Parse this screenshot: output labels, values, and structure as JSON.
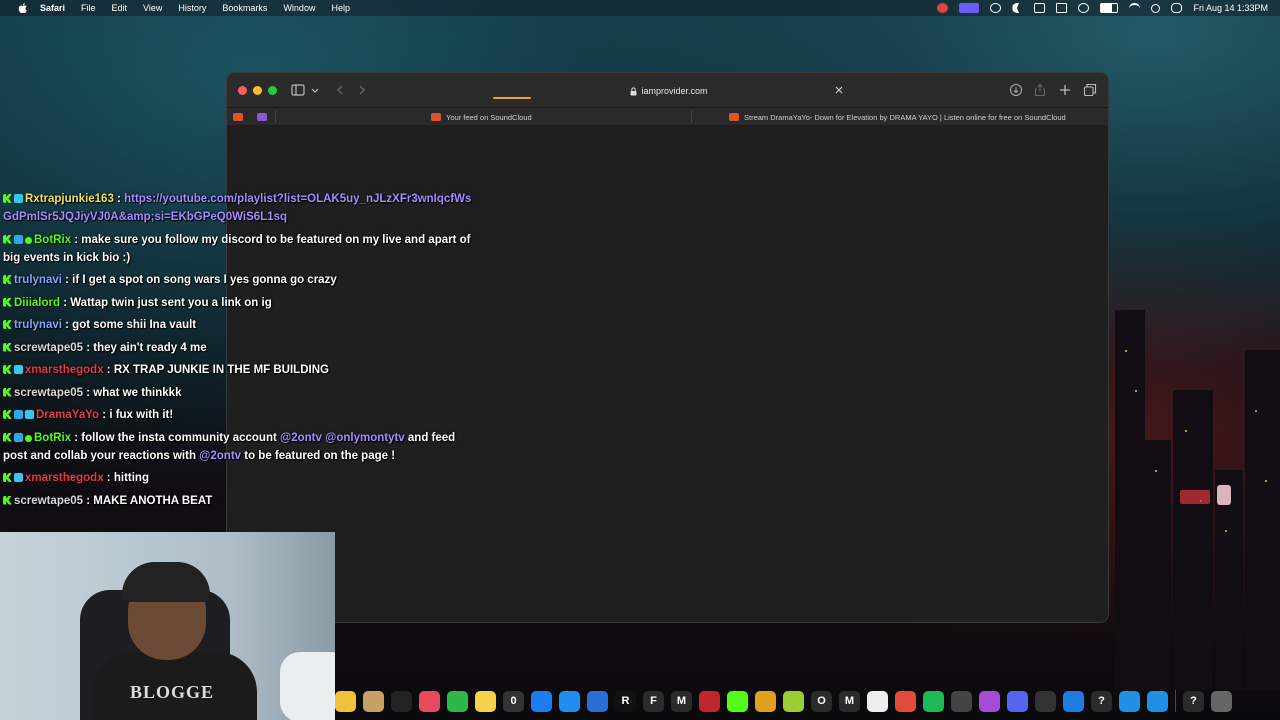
{
  "menubar": {
    "app_name": "Safari",
    "items": [
      "File",
      "Edit",
      "View",
      "History",
      "Bookmarks",
      "Window",
      "Help"
    ],
    "clock": "Fri Aug 14  1:33PM"
  },
  "browser": {
    "url": "iamprovider.com",
    "tabs": [
      {
        "label": "Your feed on SoundCloud"
      },
      {
        "label": "Stream DramaYaYo- Down for Elevation by DRAMA YAYO | Listen online for free on SoundCloud"
      }
    ]
  },
  "chat": {
    "messages": [
      {
        "user": "Rxtrapjunkie163",
        "user_color": "#f5e05a",
        "text": "",
        "link": "https://youtube.com/playlist?list=OLAK5uy_nJLzXFr3wnIqcfWsGdPmlSr5JQJiyVJ0A&amp;si=EKbGPeQ0WiS6L1sq",
        "badges": [
          "kick",
          "sub"
        ]
      },
      {
        "user": "BotRix",
        "user_color": "#53fc18",
        "text": "make sure you follow my discord to be featured on my live and apart of big events in kick bio :)",
        "badges": [
          "kick",
          "bot",
          "mod"
        ]
      },
      {
        "user": "trulynavi",
        "user_color": "#7fa8ff",
        "text": "if I get a spot on song wars I yes gonna go crazy",
        "badges": [
          "kick"
        ]
      },
      {
        "user": "Diiialord",
        "user_color": "#53fc18",
        "text": "Wattap twin just sent you a link on ig",
        "badges": [
          "kick"
        ]
      },
      {
        "user": "trulynavi",
        "user_color": "#7fa8ff",
        "text": "got some shii Ina vault",
        "badges": [
          "kick"
        ]
      },
      {
        "user": "screwtape05",
        "user_color": "#d8d8d8",
        "text": "they ain't ready 4 me",
        "badges": [
          "kick"
        ]
      },
      {
        "user": "xmarsthegodx",
        "user_color": "#e63a4c",
        "text": "RX TRAP JUNKIE IN THE MF BUILDING",
        "badges": [
          "kick",
          "sub"
        ]
      },
      {
        "user": "screwtape05",
        "user_color": "#d8d8d8",
        "text": "what we thinkkk",
        "badges": [
          "kick"
        ]
      },
      {
        "user": "DramaYaYo",
        "user_color": "#e63a4c",
        "text": "i fux with it!",
        "badges": [
          "kick",
          "bot",
          "sub"
        ]
      },
      {
        "user": "BotRix",
        "user_color": "#53fc18",
        "text_parts": [
          "follow the insta community account ",
          "@2ontv",
          " ",
          "@onlymontytv",
          " and feed post and collab your reactions with ",
          "@2ontv",
          " to be featured on the page !"
        ],
        "badges": [
          "kick",
          "bot",
          "mod"
        ]
      },
      {
        "user": "xmarsthegodx",
        "user_color": "#e63a4c",
        "text": "hitting",
        "badges": [
          "kick",
          "sub"
        ]
      },
      {
        "user": "screwtape05",
        "user_color": "#d8d8d8",
        "text": "MAKE ANOTHA BEAT",
        "badges": [
          "kick"
        ]
      }
    ]
  },
  "webcam": {
    "shirt_text": "BLOGGE"
  },
  "dock": {
    "icons": [
      "photos-icon",
      "notes-app-icon",
      "apple-tv-icon",
      "news-icon",
      "numbers-icon",
      "notes-icon",
      "0-app-icon",
      "xcode-icon",
      "app-store-icon",
      "keynote-icon",
      "r-app-icon",
      "f-app-icon",
      "m-app-icon",
      "record-icon",
      "kick-icon",
      "tweak-icon",
      "xbox-icon",
      "o-app-icon",
      "m2-app-icon",
      "finder-icon",
      "chrome-icon",
      "spotify-icon",
      "obs-icon",
      "podcasts-icon",
      "discord-icon",
      "activity-icon",
      "bluetooth-icon",
      "help-icon",
      "safari-icon",
      "safari2-icon",
      "help2-icon",
      "trash-icon"
    ],
    "labels": {
      "0-app-icon": "0",
      "r-app-icon": "R",
      "f-app-icon": "F",
      "m-app-icon": "M",
      "o-app-icon": "O",
      "m2-app-icon": "M",
      "help-icon": "?",
      "help2-icon": "?"
    }
  }
}
